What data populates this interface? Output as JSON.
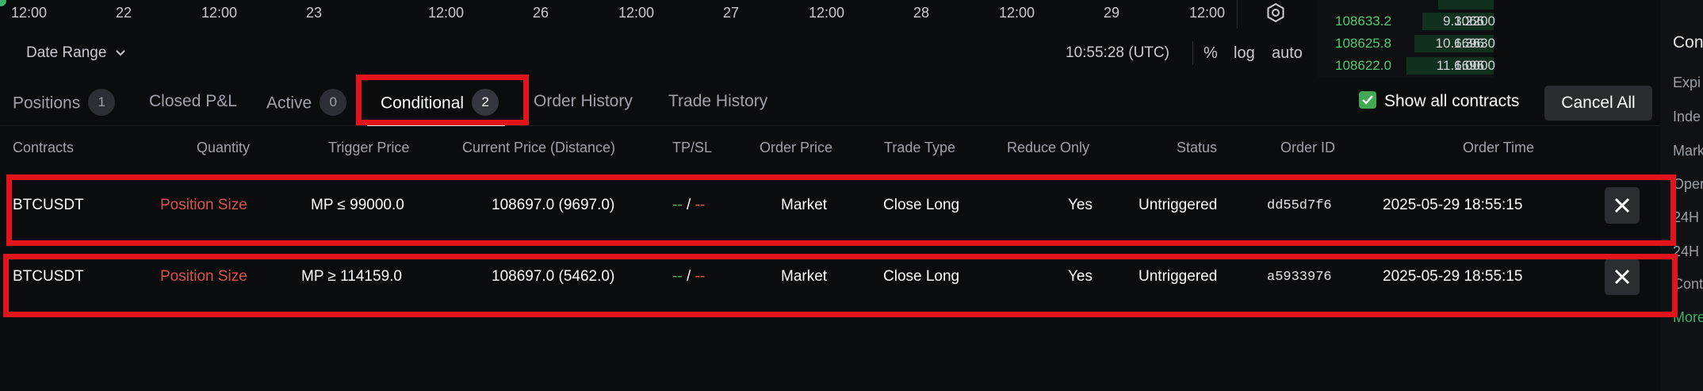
{
  "chart": {
    "time_ticks": [
      "12:00",
      "22",
      "12:00",
      "23",
      "12:00",
      "26",
      "12:00",
      "27",
      "12:00",
      "28",
      "12:00",
      "29",
      "12:00"
    ],
    "date_range_label": "Date Range",
    "clock": "10:55:28 (UTC)",
    "scale_buttons": [
      "%",
      "log",
      "auto"
    ]
  },
  "orderbook": {
    "rows": [
      {
        "price": "108633.2",
        "size": "1.2200",
        "total": "9.3066",
        "depth": 0.8
      },
      {
        "price": "108625.8",
        "size": "1.3630",
        "total": "10.6696",
        "depth": 0.9
      },
      {
        "price": "108622.0",
        "size": "1.0000",
        "total": "11.6696",
        "depth": 1.0
      }
    ]
  },
  "right_panel": {
    "items": [
      "Con",
      "Expi",
      "Inde",
      "Mark",
      "Oper",
      "24H",
      "24H",
      "Cont",
      "More"
    ]
  },
  "tabs": [
    {
      "label": "Positions",
      "badge": "1"
    },
    {
      "label": "Closed P&L",
      "badge": ""
    },
    {
      "label": "Active",
      "badge": "0"
    },
    {
      "label": "Conditional",
      "badge": "2"
    },
    {
      "label": "Order History",
      "badge": ""
    },
    {
      "label": "Trade History",
      "badge": ""
    }
  ],
  "show_all_contracts": {
    "label": "Show all contracts",
    "checked": true
  },
  "cancel_all_label": "Cancel All",
  "table": {
    "headers": [
      "Contracts",
      "Quantity",
      "Trigger Price",
      "Current Price (Distance)",
      "TP/SL",
      "Order Price",
      "Trade Type",
      "Reduce Only",
      "Status",
      "Order ID",
      "Order Time"
    ],
    "rows": [
      {
        "contract": "BTCUSDT",
        "quantity": "Position Size",
        "trigger": "MP ≤ 99000.0",
        "current": "108697.0 (9697.0)",
        "tp": "--",
        "sep": "/",
        "sl": "--",
        "order_price": "Market",
        "trade_type": "Close Long",
        "reduce_only": "Yes",
        "status": "Untriggered",
        "order_id": "dd55d7f6",
        "order_time": "2025-05-29 18:55:15"
      },
      {
        "contract": "BTCUSDT",
        "quantity": "Position Size",
        "trigger": "MP ≥ 114159.0",
        "current": "108697.0 (5462.0)",
        "tp": "--",
        "sep": "/",
        "sl": "--",
        "order_price": "Market",
        "trade_type": "Close Long",
        "reduce_only": "Yes",
        "status": "Untriggered",
        "order_id": "a5933976",
        "order_time": "2025-05-29 18:55:15"
      }
    ]
  }
}
